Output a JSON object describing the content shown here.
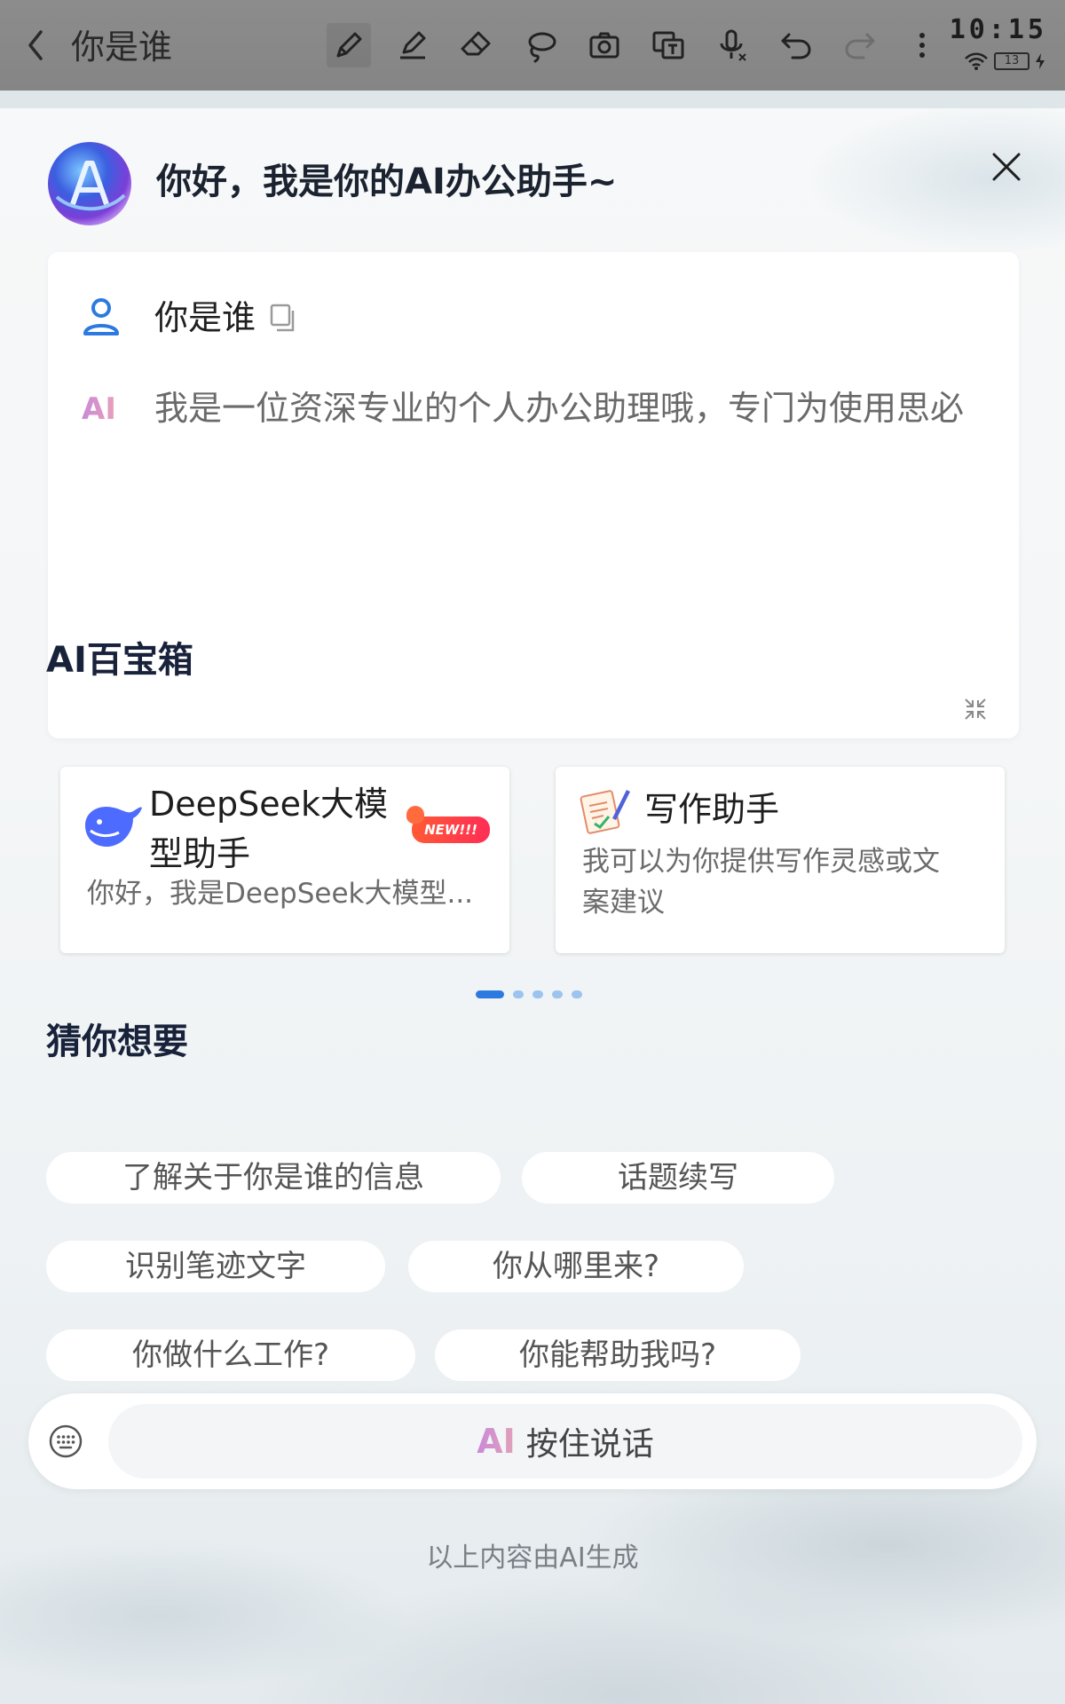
{
  "toolbar": {
    "title": "你是谁",
    "tools": [
      "pen-icon",
      "highlighter-icon",
      "eraser-icon",
      "lasso-icon",
      "camera-icon",
      "translate-icon",
      "voice-input-icon",
      "undo-icon",
      "redo-icon",
      "more-icon"
    ]
  },
  "status": {
    "time": "10:15",
    "battery": "13"
  },
  "assistant": {
    "greeting": "你好，我是你的AI办公助手~"
  },
  "chat": {
    "user_message": "你是谁",
    "ai_label": "AI",
    "ai_message": "我是一位资深专业的个人办公助理哦，专门为使用思必"
  },
  "toolbox": {
    "title": "AI百宝箱",
    "cards": [
      {
        "name": "DeepSeek大模型助手",
        "desc": "你好，我是DeepSeek大模型...",
        "badge": "NEW!!!"
      },
      {
        "name": "写作助手",
        "desc_line1": "我可以为你提供写作灵感或文",
        "desc_line2": "案建议"
      }
    ],
    "page_count": 5,
    "active_page": 1
  },
  "suggestions": {
    "title": "猜你想要",
    "chips": [
      "了解关于你是谁的信息",
      "话题续写",
      "识别笔迹文字",
      "你从哪里来?",
      "你做什么工作?",
      "你能帮助我吗?"
    ]
  },
  "input": {
    "voice_prefix": "AI",
    "voice_label": "按住说话"
  },
  "footer": {
    "note": "以上内容由AI生成"
  },
  "colors": {
    "accent": "#2c7ae0",
    "ai_gradient_start": "#c98ad8",
    "ai_gradient_end": "#e9a0b8"
  }
}
